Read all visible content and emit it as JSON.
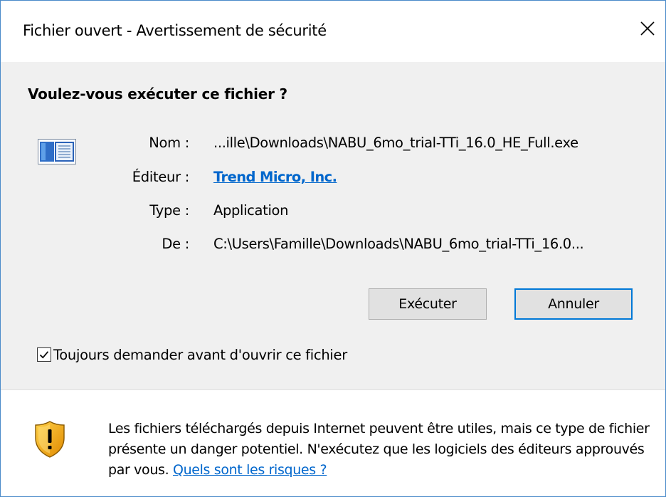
{
  "window": {
    "title": "Fichier ouvert - Avertissement de sécurité",
    "close_icon": "close-x-icon"
  },
  "dialog": {
    "question": "Voulez-vous exécuter ce fichier ?",
    "file_icon": "application-window-icon",
    "fields": {
      "name_label": "Nom :",
      "name_value": "...ille\\Downloads\\NABU_6mo_trial-TTi_16.0_HE_Full.exe",
      "publisher_label": "Éditeur :",
      "publisher_value": "Trend Micro, Inc.",
      "type_label": "Type :",
      "type_value": "Application",
      "from_label": "De :",
      "from_value": "C:\\Users\\Famille\\Downloads\\NABU_6mo_trial-TTi_16.0..."
    },
    "buttons": {
      "run_label": "Exécuter",
      "cancel_label": "Annuler"
    },
    "checkbox": {
      "label": "Toujours demander avant d'ouvrir ce fichier",
      "checked": true
    }
  },
  "warning": {
    "icon": "security-shield-icon",
    "text": "Les fichiers téléchargés depuis Internet peuvent être utiles, mais ce type de fichier présente un danger potentiel. N'exécutez que les logiciels des éditeurs approuvés par vous.",
    "link_label": "Quels sont les risques ?"
  },
  "colors": {
    "accent": "#0078d7",
    "link": "#0066cc",
    "panel_background": "#f0f0f0",
    "window_border": "#4a8ac9"
  }
}
